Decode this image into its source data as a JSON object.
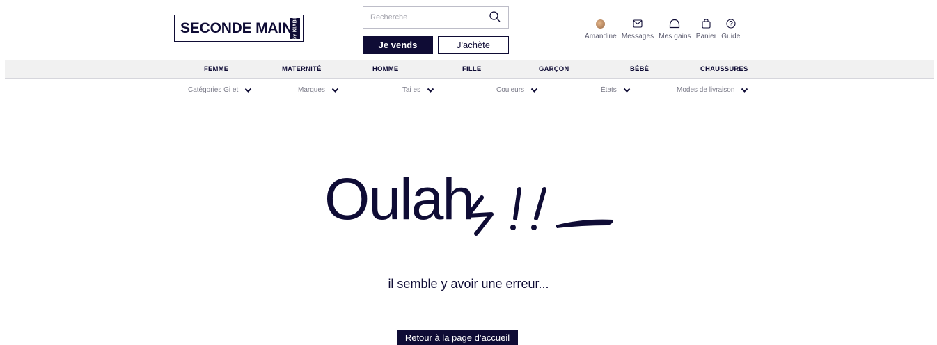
{
  "header": {
    "logo_text": "SECONDE MAIN",
    "logo_badge": "by KIABI",
    "search_placeholder": "Recherche",
    "sell_label": "Je vends",
    "buy_label": "J'achète",
    "user_nav": [
      {
        "label": "Amandine",
        "icon": "avatar"
      },
      {
        "label": "Messages",
        "icon": "envelope-icon"
      },
      {
        "label": "Mes gains",
        "icon": "wallet-icon"
      },
      {
        "label": "Panier",
        "icon": "bag-icon"
      },
      {
        "label": "Guide",
        "icon": "help-icon"
      }
    ]
  },
  "categories": [
    "FEMME",
    "MATERNITÉ",
    "HOMME",
    "FILLE",
    "GARÇON",
    "BÉBÉ",
    "CHAUSSURES"
  ],
  "filters": [
    "Catégories Gi et",
    "Marques",
    "Tai es",
    "Couleurs",
    "États",
    "Modes de livraison"
  ],
  "error": {
    "title": "Oulah",
    "message": "il semble y avoir une erreur...",
    "home_button": "Retour à la page d’accueil"
  },
  "colors": {
    "brand": "#0f0c35",
    "category_bar": "#f1f1f1"
  }
}
